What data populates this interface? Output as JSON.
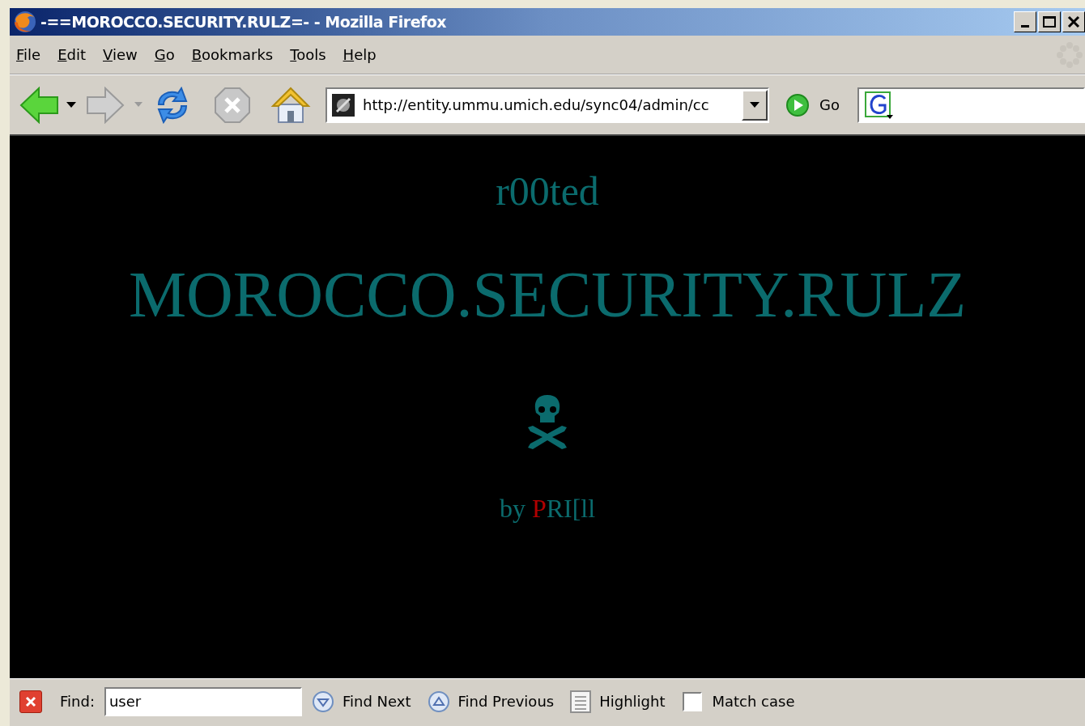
{
  "window": {
    "title": "-==MOROCCO.SECURITY.RULZ=- - Mozilla Firefox"
  },
  "menu": [
    "File",
    "Edit",
    "View",
    "Go",
    "Bookmarks",
    "Tools",
    "Help"
  ],
  "toolbar": {
    "address": "http://entity.ummu.umich.edu/sync04/admin/cc",
    "go_label": "Go"
  },
  "page": {
    "heading": "r00ted",
    "title": "MOROCCO.SECURITY.RULZ",
    "byline": [
      {
        "text": "by ",
        "color": "#0b6b6d"
      },
      {
        "text": "P",
        "color": "#b00000"
      },
      {
        "text": "RI[ll",
        "color": "#0b6b6d"
      }
    ]
  },
  "find_bar": {
    "label": "Find:",
    "value": "user",
    "buttons": [
      {
        "label": "Find Next",
        "kind": "next"
      },
      {
        "label": "Find Previous",
        "kind": "previous"
      },
      {
        "label": "Highlight",
        "kind": "highlight"
      }
    ],
    "match_case": {
      "label": "Match case",
      "checked": false
    }
  }
}
